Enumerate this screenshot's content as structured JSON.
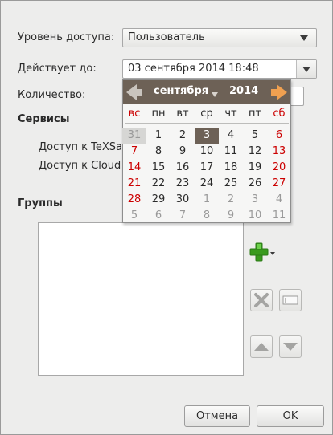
{
  "form": {
    "access_level_label": "Уровень доступа:",
    "access_level_value": "Пользователь",
    "valid_until_label": "Действует до:",
    "valid_until_value": "03 сентября 2014 18:48",
    "quantity_label": "Количество:",
    "services_heading": "Сервисы",
    "services": [
      "Доступ к TeXSa",
      "Доступ к Cloud"
    ],
    "groups_heading": "Группы"
  },
  "calendar": {
    "month": "сентября",
    "year": "2014",
    "weekdays": [
      "вс",
      "пн",
      "вт",
      "ср",
      "чт",
      "пт",
      "сб"
    ],
    "weeks": [
      [
        "31",
        "1",
        "2",
        "3",
        "4",
        "5",
        "6"
      ],
      [
        "7",
        "8",
        "9",
        "10",
        "11",
        "12",
        "13"
      ],
      [
        "14",
        "15",
        "16",
        "17",
        "18",
        "19",
        "20"
      ],
      [
        "21",
        "22",
        "23",
        "24",
        "25",
        "26",
        "27"
      ],
      [
        "28",
        "29",
        "30",
        "1",
        "2",
        "3",
        "4"
      ],
      [
        "5",
        "6",
        "7",
        "8",
        "9",
        "10",
        "11"
      ]
    ],
    "selected_day": "3",
    "colors": {
      "header": "#6d6156",
      "weekend": "#cc0000",
      "other_month": "#9a9a9a",
      "selected_bg": "#6d6156"
    }
  },
  "buttons": {
    "cancel": "Отмена",
    "ok": "OK"
  },
  "icons": {
    "add": "add-icon",
    "remove": "remove-icon",
    "edit": "edit-icon",
    "up": "move-up-icon",
    "down": "move-down-icon"
  }
}
